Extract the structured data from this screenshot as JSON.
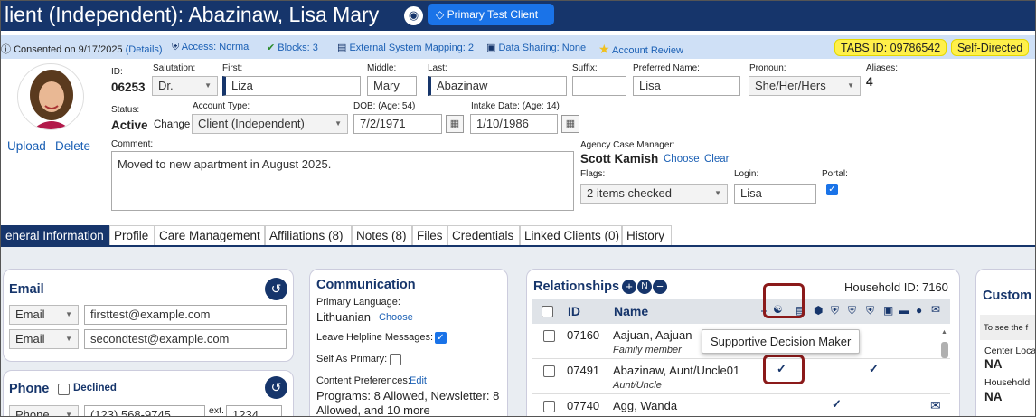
{
  "header": {
    "title": "lient (Independent): Abazinaw, Lisa Mary",
    "tag_icon": "tag-icon",
    "primary_badge": "Primary Test Client",
    "primary_badge_icon": "tag-outline-icon"
  },
  "infobar": {
    "consent": "Consented on 9/17/2025",
    "consent_details": "(Details)",
    "access": "Access: Normal",
    "blocks": "Blocks: 3",
    "mapping": "External System Mapping: 2",
    "sharing": "Data Sharing: None",
    "review": "Account Review",
    "tabs_id": "TABS ID: 09786542",
    "self_directed": "Self-Directed"
  },
  "photo": {
    "upload": "Upload",
    "delete": "Delete"
  },
  "form": {
    "id_label": "ID:",
    "id_value": "06253",
    "salutation_label": "Salutation:",
    "salutation_value": "Dr.",
    "first_label": "First:",
    "first_value": "Liza",
    "middle_label": "Middle:",
    "middle_value": "Mary",
    "last_label": "Last:",
    "last_value": "Abazinaw",
    "suffix_label": "Suffix:",
    "suffix_value": "",
    "preferred_label": "Preferred Name:",
    "preferred_value": "Lisa",
    "pronoun_label": "Pronoun:",
    "pronoun_value": "She/Her/Hers",
    "aliases_label": "Aliases:",
    "aliases_value": "4",
    "status_label": "Status:",
    "status_value": "Active",
    "status_change": "Change",
    "account_label": "Account Type:",
    "account_value": "Client (Independent)",
    "dob_label": "DOB: (Age: 54)",
    "dob_value": "7/2/1971",
    "intake_label": "Intake Date: (Age: 14)",
    "intake_value": "1/10/1986",
    "comment_label": "Comment:",
    "comment_value": "Moved to new apartment in August 2025.",
    "manager_label": "Agency Case Manager:",
    "manager_value": "Scott Kamish",
    "manager_choose": "Choose",
    "manager_clear": "Clear",
    "flags_label": "Flags:",
    "flags_value": "2 items checked",
    "login_label": "Login:",
    "login_value": "Lisa",
    "portal_label": "Portal:"
  },
  "tabs": [
    {
      "label": "eneral Information",
      "active": true
    },
    {
      "label": "Profile"
    },
    {
      "label": "Care Management"
    },
    {
      "label": "Affiliations (8)"
    },
    {
      "label": "Notes (8)"
    },
    {
      "label": "Files"
    },
    {
      "label": "Credentials"
    },
    {
      "label": "Linked Clients (0)"
    },
    {
      "label": "History"
    }
  ],
  "email": {
    "title": "Email",
    "rows": [
      {
        "type": "Email",
        "value": "firsttest@example.com"
      },
      {
        "type": "Email",
        "value": "secondtest@example.com"
      }
    ]
  },
  "phone": {
    "title": "Phone",
    "declined": "Declined",
    "type": "Phone",
    "value": "(123) 568-9745",
    "ext_label": "ext.",
    "ext_value": "1234"
  },
  "communication": {
    "title": "Communication",
    "language_label": "Primary Language:",
    "language_value": "Lithuanian",
    "language_choose": "Choose",
    "helpline_label": "Leave Helpline Messages:",
    "self_primary_label": "Self As Primary:",
    "content_label": "Content Preferences:",
    "content_edit": "Edit",
    "content_value": "Programs: 8 Allowed, Newsletter: 8 Allowed, and 10 more"
  },
  "relationships": {
    "title": "Relationships",
    "household": "Household ID: 7160",
    "col_id": "ID",
    "col_name": "Name",
    "tooltip": "Supportive Decision Maker",
    "rows": [
      {
        "id": "07160",
        "name": "Aajuan, Aajuan",
        "sub": "Family member"
      },
      {
        "id": "07491",
        "name": "Abazinaw, Aunt/Uncle01",
        "sub": "Aunt/Uncle"
      },
      {
        "id": "07740",
        "name": "Agg, Wanda",
        "sub": ""
      }
    ],
    "checkmark": "✓"
  },
  "custom": {
    "title": "Custom",
    "note": "To see the f",
    "center_label": "Center Loca",
    "center_value": "NA",
    "household_label": "Household",
    "household_value": "NA"
  },
  "colors": {
    "navy": "#16356b",
    "accent": "#1a73e8",
    "badge_yellow": "#fff04a",
    "info_bg": "#cfe0f6",
    "highlight_red": "#8b1a1a"
  }
}
